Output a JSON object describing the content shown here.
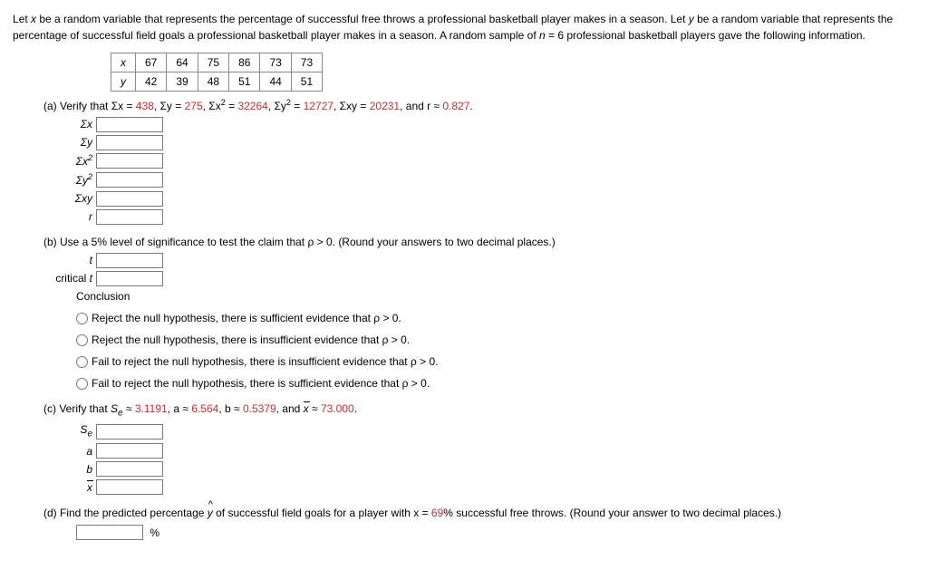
{
  "intro": {
    "text": "Let x be a random variable that represents the percentage of successful free throws a professional basketball player makes in a season. Let y be a random variable that represents the percentage of successful field goals a professional basketball player makes in a season. A random sample of n = 6 professional basketball players gave the following information."
  },
  "table": {
    "x_label": "x",
    "y_label": "y",
    "x": [
      "67",
      "64",
      "75",
      "86",
      "73",
      "73"
    ],
    "y": [
      "42",
      "39",
      "48",
      "51",
      "44",
      "51"
    ]
  },
  "partA": {
    "prefix": "(a) Verify that Σx = ",
    "v1": "438",
    "t2": ", Σy = ",
    "v2": "275",
    "t3": ", Σx",
    "sup3": "2",
    "t3b": " = ",
    "v3": "32264",
    "t4": ", Σy",
    "sup4": "2",
    "t4b": " = ",
    "v4": "12727",
    "t5": ", Σxy = ",
    "v5": "20231",
    "t6": ", and r ≈ ",
    "v6": "0.827",
    "t7": ".",
    "labels": {
      "sx": "Σx",
      "sy": "Σy",
      "sx2_pre": "Σx",
      "sy2_pre": "Σy",
      "sxy": "Σxy",
      "r": "r"
    }
  },
  "partB": {
    "text": "(b) Use a 5% level of significance to test the claim that ρ > 0. (Round your answers to two decimal places.)",
    "t_label": "t",
    "crit_label": "critical t",
    "conclusion_label": "Conclusion",
    "options": [
      "Reject the null hypothesis, there is sufficient evidence that ρ > 0.",
      "Reject the null hypothesis, there is insufficient evidence that ρ > 0.",
      "Fail to reject the null hypothesis, there is insufficient evidence that ρ > 0.",
      "Fail to reject the null hypothesis, there is sufficient evidence that ρ > 0."
    ]
  },
  "partC": {
    "prefix": "(c) Verify that ",
    "se_sym": "S",
    "se_sub": "e",
    "t1": " ≈ ",
    "v1": "3.1191",
    "t2": ", a ≈ ",
    "v2": "6.564",
    "t3": ", b ≈ ",
    "v3": "0.5379",
    "t4": ", and ",
    "xbar": "x",
    "t5": " ≈ ",
    "v4": "73.000",
    "t6": ".",
    "labels": {
      "se_pre": "S",
      "se_sub": "e",
      "a": "a",
      "b": "b",
      "xbar": "x"
    }
  },
  "partD": {
    "prefix": "(d) Find the predicted percentage ",
    "yhat": "y",
    "mid": " of successful field goals for a player with x = ",
    "v1": "69",
    "suffix": "% successful free throws. (Round your answer to two decimal places.)",
    "unit": "%"
  }
}
